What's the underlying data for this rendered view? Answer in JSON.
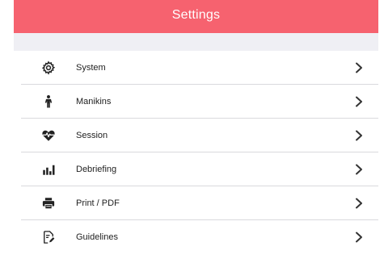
{
  "header": {
    "title": "Settings"
  },
  "menu": {
    "items": [
      {
        "label": "System",
        "icon": "gear-icon"
      },
      {
        "label": "Manikins",
        "icon": "person-icon"
      },
      {
        "label": "Session",
        "icon": "heartbeat-icon"
      },
      {
        "label": "Debriefing",
        "icon": "bar-chart-icon"
      },
      {
        "label": "Print / PDF",
        "icon": "printer-icon"
      },
      {
        "label": "Guidelines",
        "icon": "document-edit-icon"
      }
    ]
  },
  "colors": {
    "header_bg": "#f6626f",
    "header_text": "#ffffff",
    "separator_band": "#efeff4",
    "icon": "#222222",
    "chevron": "#333333"
  }
}
